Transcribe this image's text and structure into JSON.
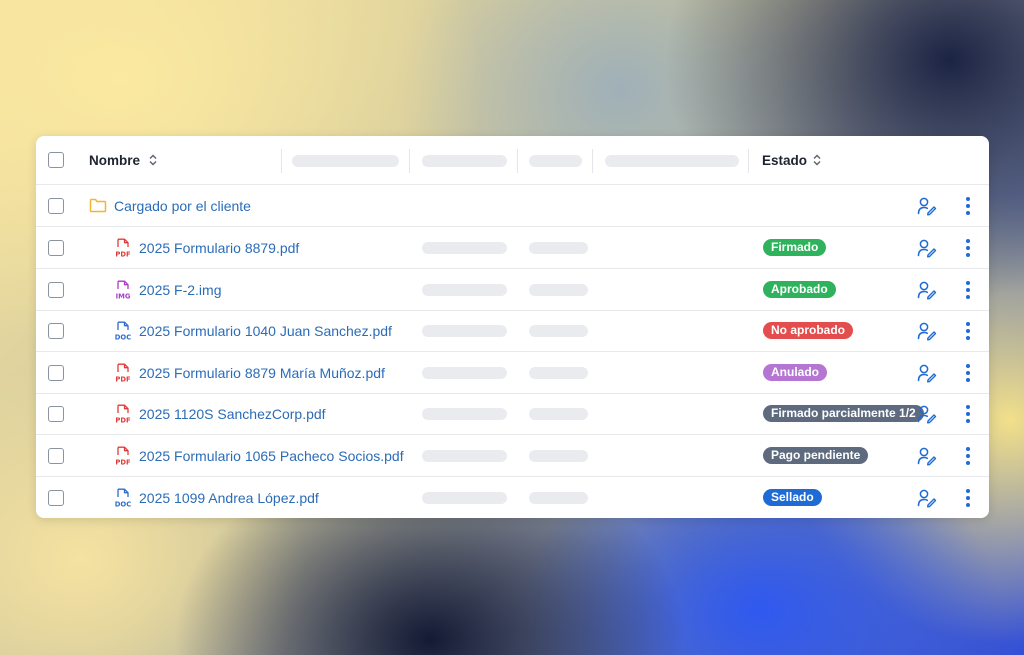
{
  "table": {
    "columns": {
      "name": "Nombre",
      "status": "Estado"
    },
    "folder": {
      "label": "Cargado por el cliente",
      "icon": "folder-icon"
    },
    "rows": [
      {
        "name": "2025 Formulario 8879.pdf",
        "type": "PDF",
        "status": "Firmado",
        "status_color": "#2fb25c"
      },
      {
        "name": "2025 F-2.img",
        "type": "IMG",
        "status": "Aprobado",
        "status_color": "#2fb25c"
      },
      {
        "name": "2025 Formulario 1040 Juan Sanchez.pdf",
        "type": "DOC",
        "status": "No aprobado",
        "status_color": "#e34d4d"
      },
      {
        "name": "2025 Formulario 8879 María Muñoz.pdf",
        "type": "PDF",
        "status": "Anulado",
        "status_color": "#b476d2"
      },
      {
        "name": "2025 1120S SanchezCorp.pdf",
        "type": "PDF",
        "status": "Firmado parcialmente 1/2",
        "status_color": "#5e6b7e"
      },
      {
        "name": "2025 Formulario 1065 Pacheco Socios.pdf",
        "type": "PDF",
        "status": "Pago pendiente",
        "status_color": "#5e6b7e"
      },
      {
        "name": "2025 1099 Andrea López.pdf",
        "type": "DOC",
        "status": "Sellado",
        "status_color": "#1f6bd6"
      }
    ]
  },
  "colors": {
    "link": "#2b6cb8",
    "accent": "#1f6bd6",
    "pdf": "#e23b3b",
    "img": "#a93cc9",
    "doc": "#2c6bd0"
  }
}
